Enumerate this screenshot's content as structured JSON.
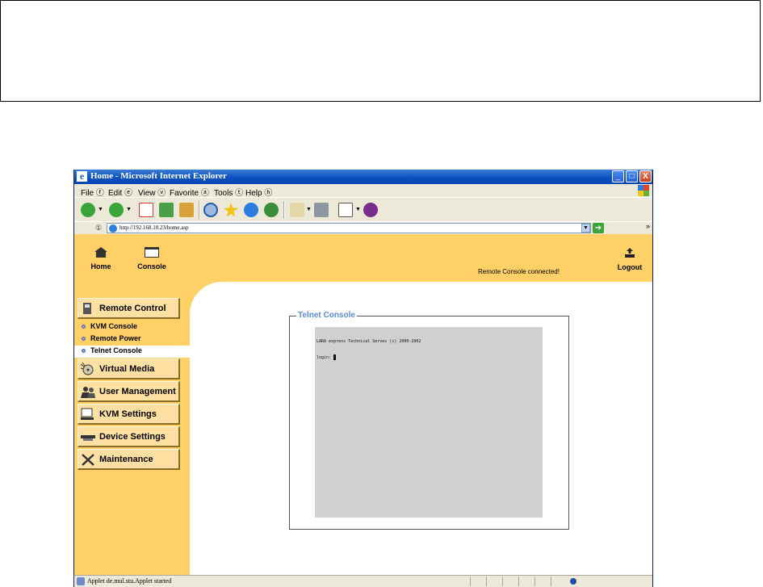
{
  "window": {
    "title": "Home - Microsoft Internet Explorer",
    "min": "_",
    "max": "□",
    "close": "X",
    "menu": [
      "File ⓕ",
      "Edit ⓔ",
      "View ⓥ",
      "Favorite ⓐ",
      "Tools ⓣ",
      "Help ⓗ"
    ],
    "address_label": "①",
    "address": "http://192.168.10.23/home.asp",
    "overflow": "»"
  },
  "header": {
    "home_label": "Home",
    "console_label": "Console",
    "status": "Remote Console connected!",
    "logout_label": "Logout"
  },
  "sidebar": {
    "remote_control": "Remote Control",
    "sub_items": [
      "KVM Console",
      "Remote Power",
      "Telnet Console"
    ],
    "active_sub": "Telnet Console",
    "virtual_media": "Virtual Media",
    "user_management": "User Management",
    "kvm_settings": "KVM Settings",
    "device_settings": "Device Settings",
    "maintenance": "Maintenance"
  },
  "telnet": {
    "title": "Telnet Console",
    "line1": "LARA express Technical Serves (c) 2000-2002",
    "line2": "login:"
  },
  "statusbar": {
    "text": "Applet de.mul.stu.Applet started"
  },
  "colors": {
    "header_bg": "#ffd066",
    "accent": "#5a8ad0",
    "terminal_bg": "#d0d0d0"
  }
}
